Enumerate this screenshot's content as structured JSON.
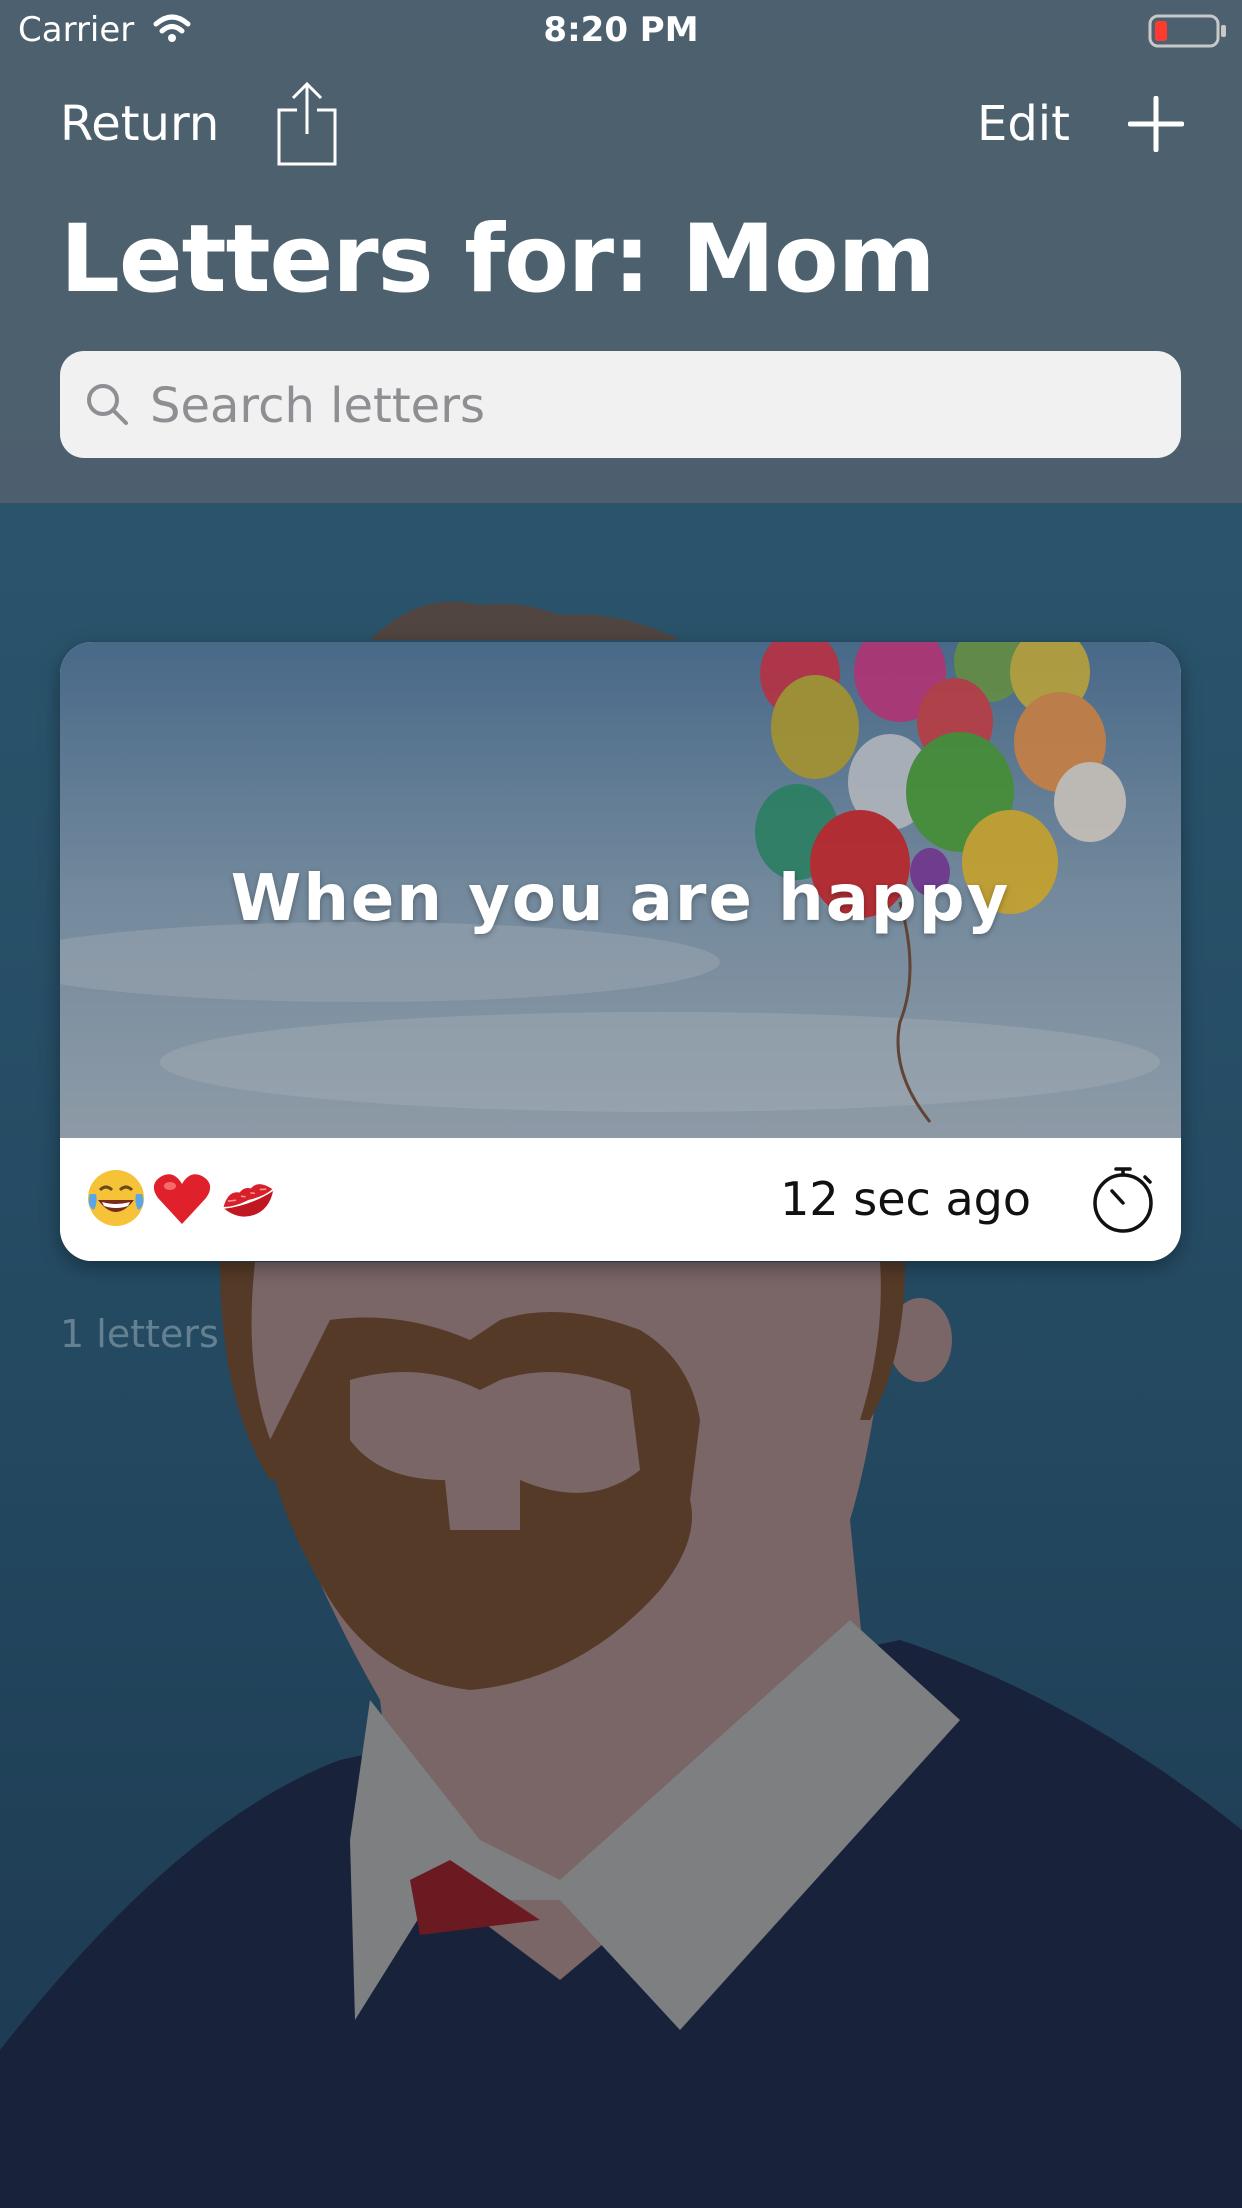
{
  "status_bar": {
    "carrier": "Carrier",
    "time": "8:20 PM"
  },
  "nav": {
    "return_label": "Return",
    "edit_label": "Edit"
  },
  "page_title": "Letters for: Mom",
  "search": {
    "placeholder": "Search letters",
    "value": ""
  },
  "letters": [
    {
      "title": "When you are happy",
      "reactions": [
        "face-with-tears-of-joy-icon",
        "red-heart-icon",
        "kiss-mark-icon"
      ],
      "timestamp": "12 sec ago"
    }
  ],
  "count_label": "1 letters",
  "colors": {
    "header": "#4e606e",
    "background": "#203a4e",
    "battery_low": "#ff3b30"
  }
}
